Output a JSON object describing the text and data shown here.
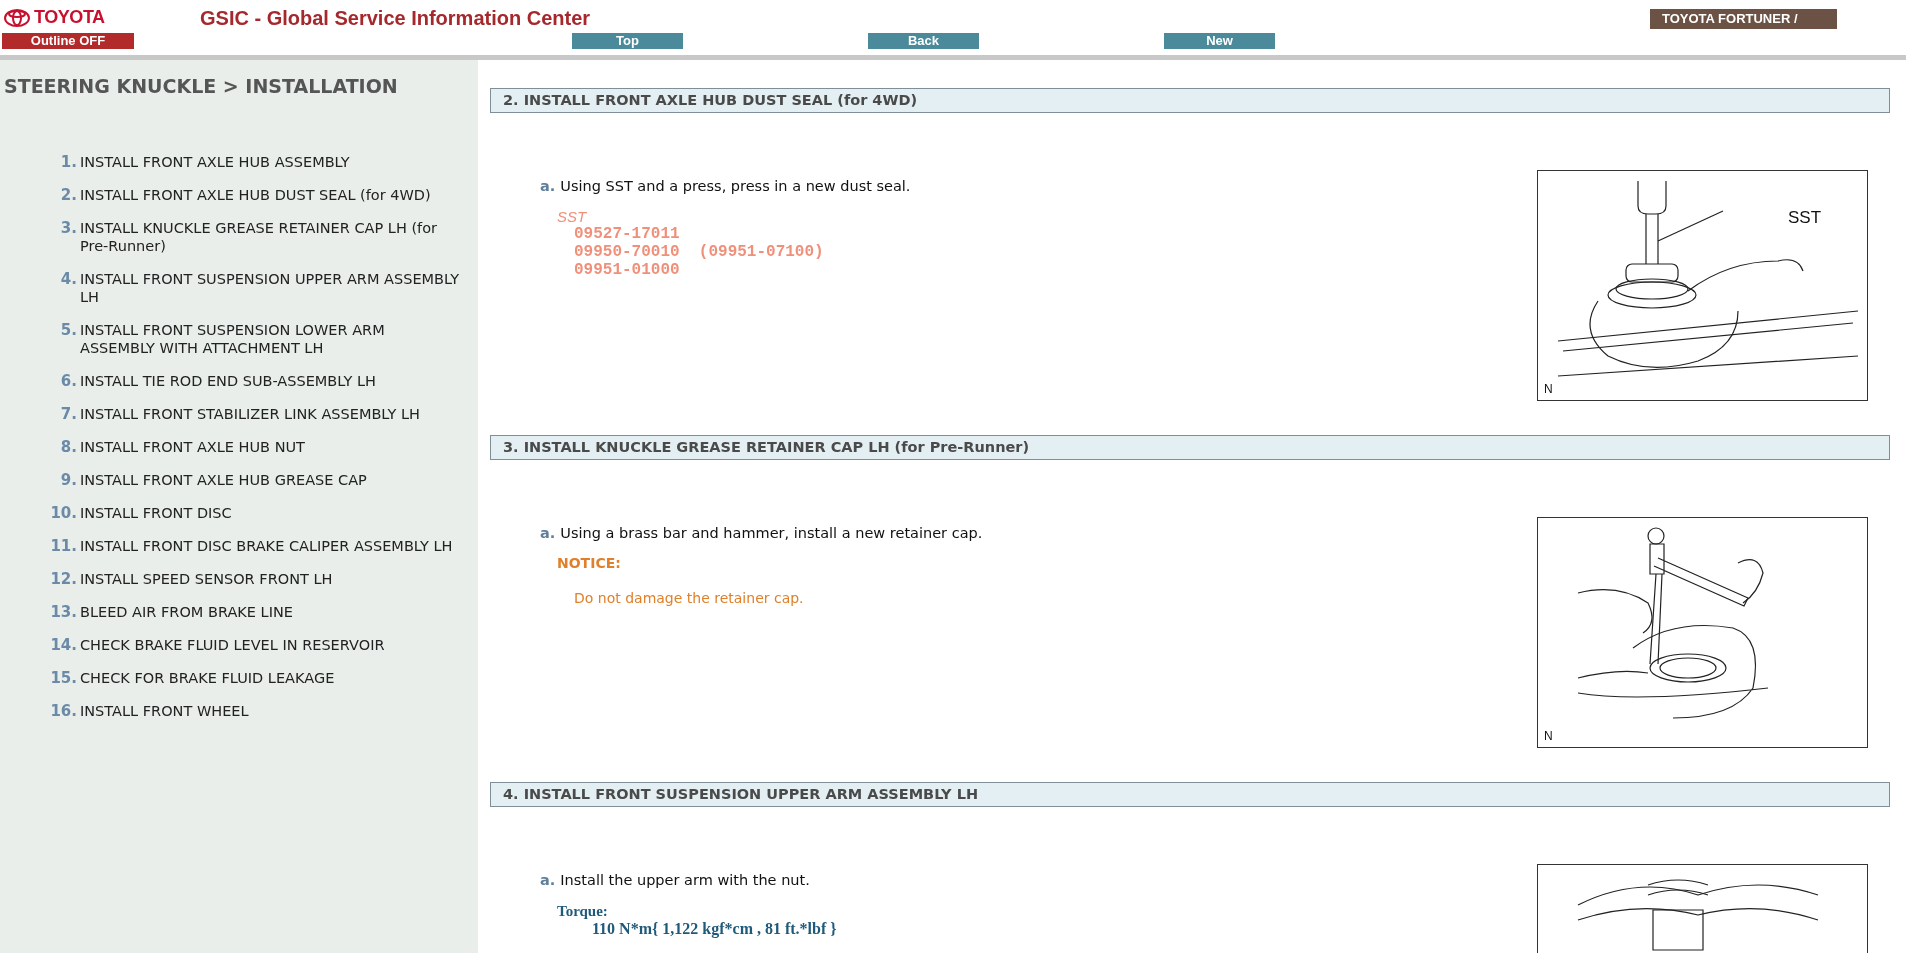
{
  "header": {
    "logo": "TOYOTA",
    "title": "GSIC - Global Service Information Center",
    "outline_button": "Outline OFF",
    "nav_buttons": [
      "Top",
      "Back",
      "New"
    ],
    "vehicle_button": "TOYOTA FORTUNER /"
  },
  "sidebar": {
    "title": "STEERING KNUCKLE > INSTALLATION",
    "items": [
      {
        "number": "1.",
        "label": "INSTALL FRONT AXLE HUB ASSEMBLY"
      },
      {
        "number": "2.",
        "label": "INSTALL FRONT AXLE HUB DUST SEAL (for 4WD)"
      },
      {
        "number": "3.",
        "label": "INSTALL KNUCKLE GREASE RETAINER CAP LH (for Pre-Runner)"
      },
      {
        "number": "4.",
        "label": "INSTALL FRONT SUSPENSION UPPER ARM ASSEMBLY LH"
      },
      {
        "number": "5.",
        "label": "INSTALL FRONT SUSPENSION LOWER ARM ASSEMBLY WITH ATTACHMENT LH"
      },
      {
        "number": "6.",
        "label": "INSTALL TIE ROD END SUB-ASSEMBLY LH"
      },
      {
        "number": "7.",
        "label": "INSTALL FRONT STABILIZER LINK ASSEMBLY LH"
      },
      {
        "number": "8.",
        "label": "INSTALL FRONT AXLE HUB NUT"
      },
      {
        "number": "9.",
        "label": "INSTALL FRONT AXLE HUB GREASE CAP"
      },
      {
        "number": "10.",
        "label": "INSTALL FRONT DISC"
      },
      {
        "number": "11.",
        "label": "INSTALL FRONT DISC BRAKE CALIPER ASSEMBLY LH"
      },
      {
        "number": "12.",
        "label": "INSTALL SPEED SENSOR FRONT LH"
      },
      {
        "number": "13.",
        "label": "BLEED AIR FROM BRAKE LINE"
      },
      {
        "number": "14.",
        "label": "CHECK BRAKE FLUID LEVEL IN RESERVOIR"
      },
      {
        "number": "15.",
        "label": "CHECK FOR BRAKE FLUID LEAKAGE"
      },
      {
        "number": "16.",
        "label": "INSTALL FRONT WHEEL"
      }
    ]
  },
  "sections": [
    {
      "title": "2. INSTALL FRONT AXLE HUB DUST SEAL (for 4WD)",
      "steps": [
        {
          "marker": "a.",
          "text": "Using SST and a press, press in a new dust seal.",
          "details": [
            {
              "kind": "sst",
              "label": "SST",
              "lines": [
                "09527-17011",
                "09950-70010  (09951-07100)",
                "09951-01000"
              ]
            }
          ]
        }
      ],
      "figure": {
        "kind": "press",
        "callout": "SST",
        "corner": "N"
      }
    },
    {
      "title": "3. INSTALL KNUCKLE GREASE RETAINER CAP LH (for Pre-Runner)",
      "steps": [
        {
          "marker": "a.",
          "text": "Using a brass bar and hammer, install a new retainer cap.",
          "details": [
            {
              "kind": "notice",
              "label": "NOTICE:",
              "lines": [
                "Do not damage the retainer cap."
              ]
            }
          ]
        }
      ],
      "figure": {
        "kind": "hammer",
        "corner": "N"
      }
    },
    {
      "title": "4. INSTALL FRONT SUSPENSION UPPER ARM ASSEMBLY LH",
      "steps": [
        {
          "marker": "a.",
          "text": "Install the upper arm with the nut.",
          "details": [
            {
              "kind": "torque",
              "label": "Torque:",
              "lines": [
                "110 N*m{ 1,122 kgf*cm , 81 ft.*lbf }"
              ]
            }
          ]
        }
      ],
      "figure": {
        "kind": "spring"
      }
    }
  ]
}
